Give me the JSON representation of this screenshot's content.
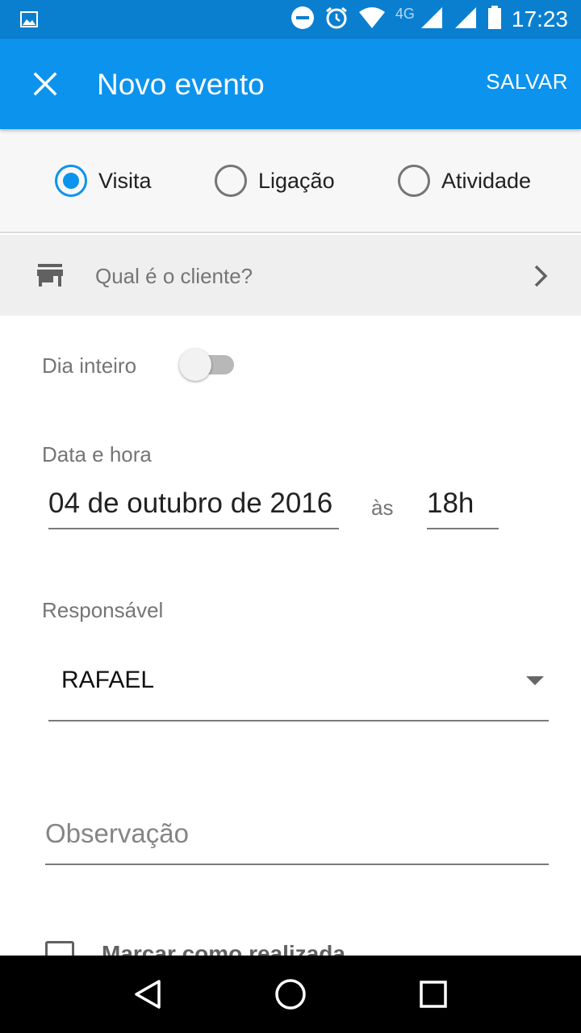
{
  "status_bar": {
    "network": "4G",
    "time": "17:23"
  },
  "app_bar": {
    "title": "Novo evento",
    "save_label": "SALVAR",
    "color": "#0c93ee"
  },
  "event_types": [
    {
      "label": "Visita",
      "selected": true
    },
    {
      "label": "Ligação",
      "selected": false
    },
    {
      "label": "Atividade",
      "selected": false
    }
  ],
  "client": {
    "placeholder": "Qual é o cliente?"
  },
  "all_day": {
    "label": "Dia inteiro",
    "enabled": false
  },
  "datetime": {
    "label": "Data e hora",
    "date": "04 de outubro de 2016",
    "conjunction": "às",
    "time": "18h"
  },
  "responsible": {
    "label": "Responsável",
    "value": "RAFAEL"
  },
  "observation": {
    "placeholder": "Observação"
  },
  "mark_done": {
    "label": "Marcar como realizada",
    "checked": false
  }
}
